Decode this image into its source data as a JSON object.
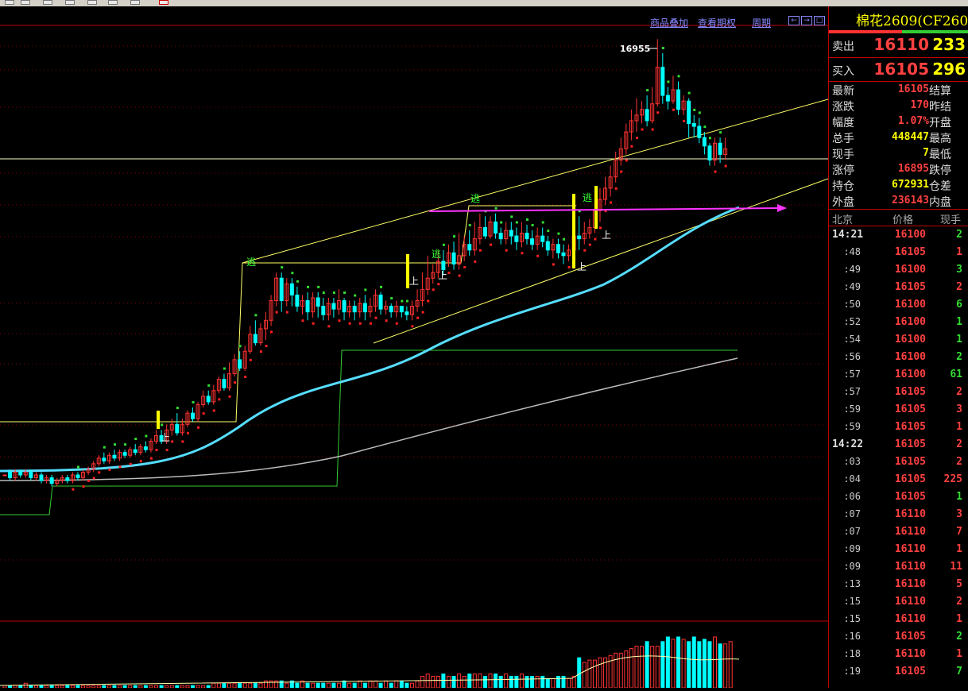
{
  "colors": {
    "background": "#000000",
    "up": "#ff3333",
    "down": "#00ffff",
    "yellow": "#ffff00",
    "green": "#33cc33",
    "magenta": "#ff33ff",
    "ma_fast": "#55ddff",
    "ma_slow": "#bbbbbb"
  },
  "toolbar": {
    "links": [
      "商品叠加",
      "查看期权",
      "周期"
    ],
    "nav_icons": [
      "zoom-in-icon",
      "zoom-out-icon",
      "restore-icon"
    ]
  },
  "chart": {
    "peak_label": "16955",
    "chart_data": {
      "type": "candlestick",
      "title": "",
      "xlabel": "",
      "ylabel": "",
      "peak_high": 16955,
      "signals": [
        "逃",
        "逃",
        "逃",
        "逃",
        "上",
        "上",
        "上",
        "上",
        "上"
      ],
      "candles": [
        [
          0.0,
          0.0,
          0.0,
          0.0
        ],
        [
          0.01,
          -0.01,
          0.02,
          -0.02
        ],
        [
          -0.01,
          0.01,
          0.02,
          -0.02
        ],
        [
          0.01,
          0.0,
          0.02,
          -0.01
        ],
        [
          0.0,
          0.01,
          0.02,
          -0.01
        ],
        [
          0.01,
          -0.01,
          0.02,
          -0.02
        ],
        [
          -0.01,
          0.0,
          0.01,
          -0.02
        ],
        [
          0.0,
          -0.02,
          0.01,
          -0.03
        ],
        [
          -0.02,
          -0.01,
          0.0,
          -0.03
        ],
        [
          -0.01,
          -0.03,
          0.0,
          -0.04
        ],
        [
          -0.03,
          -0.02,
          -0.01,
          -0.04
        ],
        [
          -0.02,
          -0.01,
          0.0,
          -0.03
        ],
        [
          -0.01,
          -0.02,
          0.0,
          -0.03
        ],
        [
          -0.02,
          0.0,
          0.01,
          -0.03
        ],
        [
          0.0,
          -0.01,
          0.01,
          -0.02
        ],
        [
          -0.01,
          0.01,
          0.02,
          -0.02
        ],
        [
          0.01,
          0.02,
          0.03,
          0.0
        ],
        [
          0.02,
          0.04,
          0.05,
          0.01
        ],
        [
          0.04,
          0.06,
          0.07,
          0.03
        ],
        [
          0.06,
          0.05,
          0.08,
          0.04
        ],
        [
          0.05,
          0.07,
          0.08,
          0.04
        ],
        [
          0.07,
          0.06,
          0.09,
          0.05
        ],
        [
          0.06,
          0.08,
          0.09,
          0.05
        ],
        [
          0.08,
          0.07,
          0.09,
          0.06
        ],
        [
          0.07,
          0.09,
          0.1,
          0.06
        ],
        [
          0.09,
          0.08,
          0.11,
          0.07
        ],
        [
          0.08,
          0.1,
          0.11,
          0.07
        ],
        [
          0.1,
          0.09,
          0.12,
          0.08
        ],
        [
          0.09,
          0.12,
          0.13,
          0.08
        ],
        [
          0.12,
          0.14,
          0.16,
          0.11
        ],
        [
          0.14,
          0.12,
          0.16,
          0.11
        ],
        [
          0.12,
          0.16,
          0.18,
          0.11
        ],
        [
          0.16,
          0.18,
          0.2,
          0.14
        ],
        [
          0.18,
          0.15,
          0.22,
          0.14
        ],
        [
          0.15,
          0.18,
          0.2,
          0.14
        ],
        [
          0.18,
          0.22,
          0.23,
          0.17
        ],
        [
          0.22,
          0.2,
          0.24,
          0.19
        ],
        [
          0.2,
          0.25,
          0.26,
          0.19
        ],
        [
          0.25,
          0.28,
          0.3,
          0.24
        ],
        [
          0.28,
          0.26,
          0.3,
          0.25
        ],
        [
          0.26,
          0.3,
          0.32,
          0.25
        ],
        [
          0.3,
          0.34,
          0.35,
          0.29
        ],
        [
          0.34,
          0.31,
          0.36,
          0.3
        ],
        [
          0.31,
          0.36,
          0.4,
          0.3
        ],
        [
          0.36,
          0.41,
          0.43,
          0.35
        ],
        [
          0.41,
          0.38,
          0.44,
          0.37
        ],
        [
          0.38,
          0.44,
          0.46,
          0.37
        ],
        [
          0.44,
          0.5,
          0.53,
          0.43
        ],
        [
          0.5,
          0.47,
          0.55,
          0.46
        ],
        [
          0.47,
          0.52,
          0.54,
          0.46
        ],
        [
          0.52,
          0.55,
          0.58,
          0.48
        ],
        [
          0.55,
          0.62,
          0.64,
          0.53
        ],
        [
          0.62,
          0.7,
          0.72,
          0.6
        ],
        [
          0.7,
          0.62,
          0.72,
          0.58
        ],
        [
          0.62,
          0.68,
          0.7,
          0.6
        ],
        [
          0.68,
          0.64,
          0.7,
          0.6
        ],
        [
          0.64,
          0.6,
          0.67,
          0.58
        ],
        [
          0.6,
          0.62,
          0.64,
          0.57
        ],
        [
          0.62,
          0.58,
          0.65,
          0.55
        ],
        [
          0.58,
          0.63,
          0.65,
          0.56
        ],
        [
          0.63,
          0.6,
          0.65,
          0.56
        ],
        [
          0.6,
          0.57,
          0.63,
          0.55
        ],
        [
          0.57,
          0.61,
          0.63,
          0.55
        ],
        [
          0.61,
          0.59,
          0.63,
          0.56
        ],
        [
          0.59,
          0.62,
          0.66,
          0.57
        ],
        [
          0.62,
          0.58,
          0.63,
          0.55
        ],
        [
          0.58,
          0.6,
          0.62,
          0.56
        ],
        [
          0.6,
          0.58,
          0.62,
          0.55
        ],
        [
          0.58,
          0.61,
          0.63,
          0.56
        ],
        [
          0.61,
          0.58,
          0.64,
          0.55
        ],
        [
          0.58,
          0.6,
          0.63,
          0.56
        ],
        [
          0.6,
          0.64,
          0.66,
          0.58
        ],
        [
          0.64,
          0.59,
          0.65,
          0.57
        ],
        [
          0.59,
          0.6,
          0.62,
          0.57
        ],
        [
          0.6,
          0.58,
          0.61,
          0.56
        ],
        [
          0.58,
          0.6,
          0.62,
          0.56
        ],
        [
          0.6,
          0.58,
          0.6,
          0.56
        ],
        [
          0.58,
          0.57,
          0.6,
          0.55
        ],
        [
          0.57,
          0.6,
          0.62,
          0.55
        ],
        [
          0.6,
          0.62,
          0.66,
          0.58
        ],
        [
          0.62,
          0.66,
          0.72,
          0.6
        ],
        [
          0.66,
          0.7,
          0.78,
          0.64
        ],
        [
          0.7,
          0.72,
          0.75,
          0.68
        ],
        [
          0.72,
          0.76,
          0.8,
          0.7
        ],
        [
          0.76,
          0.73,
          0.8,
          0.71
        ],
        [
          0.76,
          0.79,
          0.82,
          0.74
        ],
        [
          0.79,
          0.75,
          0.83,
          0.73
        ],
        [
          0.75,
          0.78,
          0.86,
          0.73
        ],
        [
          0.78,
          0.82,
          0.85,
          0.76
        ],
        [
          0.82,
          0.8,
          0.87,
          0.78
        ],
        [
          0.8,
          0.84,
          0.9,
          0.78
        ],
        [
          0.84,
          0.88,
          0.93,
          0.82
        ],
        [
          0.88,
          0.85,
          0.92,
          0.84
        ],
        [
          0.85,
          0.9,
          0.92,
          0.84
        ],
        [
          0.9,
          0.86,
          0.93,
          0.84
        ],
        [
          0.86,
          0.84,
          0.88,
          0.82
        ],
        [
          0.84,
          0.87,
          0.9,
          0.82
        ],
        [
          0.87,
          0.85,
          0.9,
          0.82
        ],
        [
          0.85,
          0.83,
          0.88,
          0.8
        ],
        [
          0.83,
          0.86,
          0.9,
          0.81
        ],
        [
          0.86,
          0.84,
          0.89,
          0.82
        ],
        [
          0.84,
          0.82,
          0.87,
          0.8
        ],
        [
          0.82,
          0.85,
          0.88,
          0.8
        ],
        [
          0.85,
          0.83,
          0.88,
          0.81
        ],
        [
          0.83,
          0.8,
          0.85,
          0.78
        ],
        [
          0.8,
          0.82,
          0.84,
          0.77
        ],
        [
          0.82,
          0.79,
          0.84,
          0.77
        ],
        [
          0.79,
          0.78,
          0.82,
          0.75
        ],
        [
          0.78,
          0.8,
          0.82,
          0.76
        ],
        [
          0.8,
          0.85,
          0.93,
          0.79
        ],
        [
          0.85,
          0.84,
          0.92,
          0.8
        ],
        [
          0.84,
          0.86,
          0.9,
          0.82
        ],
        [
          0.86,
          0.88,
          0.91,
          0.84
        ],
        [
          0.88,
          0.94,
          0.98,
          0.86
        ],
        [
          0.94,
          0.98,
          1.02,
          0.9
        ],
        [
          0.98,
          1.02,
          1.06,
          0.96
        ],
        [
          1.02,
          1.06,
          1.1,
          0.99
        ],
        [
          1.06,
          1.12,
          1.15,
          1.04
        ],
        [
          1.12,
          1.16,
          1.2,
          1.1
        ],
        [
          1.16,
          1.22,
          1.25,
          1.14
        ],
        [
          1.22,
          1.26,
          1.3,
          1.19
        ],
        [
          1.26,
          1.28,
          1.34,
          1.22
        ],
        [
          1.28,
          1.3,
          1.33,
          1.25
        ],
        [
          1.3,
          1.26,
          1.35,
          1.24
        ],
        [
          1.26,
          1.32,
          1.38,
          1.25
        ],
        [
          1.32,
          1.45,
          1.55,
          1.31
        ],
        [
          1.45,
          1.35,
          1.5,
          1.32
        ],
        [
          1.35,
          1.33,
          1.38,
          1.3
        ],
        [
          1.33,
          1.37,
          1.42,
          1.32
        ],
        [
          1.37,
          1.3,
          1.4,
          1.28
        ],
        [
          1.3,
          1.33,
          1.35,
          1.28
        ],
        [
          1.33,
          1.25,
          1.34,
          1.2
        ],
        [
          1.25,
          1.24,
          1.28,
          1.2
        ],
        [
          1.24,
          1.2,
          1.27,
          1.18
        ],
        [
          1.2,
          1.17,
          1.22,
          1.14
        ],
        [
          1.17,
          1.12,
          1.18,
          1.1
        ],
        [
          1.12,
          1.18,
          1.2,
          1.1
        ],
        [
          1.18,
          1.14,
          1.2,
          1.11
        ],
        [
          1.14,
          1.16,
          1.2,
          1.12
        ]
      ],
      "volume": [
        1,
        1,
        1,
        1,
        2,
        1,
        1,
        1,
        1,
        1,
        1,
        1,
        1,
        1,
        1,
        1,
        1,
        1,
        1,
        1,
        1,
        1,
        1,
        1,
        1,
        1,
        1,
        1,
        1,
        1,
        1,
        1,
        1,
        1,
        1,
        1,
        1,
        1,
        1,
        1,
        2,
        2,
        2,
        2,
        2,
        2,
        2,
        2,
        2,
        2,
        3,
        3,
        3,
        3,
        2,
        3,
        2,
        3,
        2,
        2,
        2,
        2,
        2,
        2,
        2,
        3,
        2,
        2,
        3,
        2,
        3,
        3,
        2,
        3,
        2,
        3,
        3,
        2,
        2,
        3,
        5,
        6,
        5,
        5,
        6,
        5,
        5,
        6,
        5,
        6,
        6,
        6,
        5,
        6,
        6,
        5,
        6,
        5,
        5,
        6,
        5,
        5,
        5,
        5,
        4,
        4,
        5,
        5,
        4,
        5,
        13,
        11,
        12,
        12,
        13,
        13,
        14,
        15,
        15,
        16,
        17,
        18,
        18,
        20,
        18,
        18,
        20,
        22,
        21,
        22,
        21,
        20,
        22,
        20,
        21,
        20,
        22,
        19,
        19,
        20
      ]
    }
  },
  "panel": {
    "title": "棉花2609(CF260",
    "sell_label": "卖出",
    "sell_price": "16110",
    "sell_vol": "233",
    "buy_label": "买入",
    "buy_price": "16105",
    "buy_vol": "296",
    "quote": [
      {
        "label": "最新",
        "value": "16105",
        "right": "结算",
        "color": "#ff4040"
      },
      {
        "label": "涨跌",
        "value": "170",
        "right": "昨结",
        "color": "#ff4040"
      },
      {
        "label": "幅度",
        "value": "1.07%",
        "right": "开盘",
        "color": "#ff4040"
      },
      {
        "label": "总手",
        "value": "448447",
        "right": "最高",
        "color": "#ffff00"
      },
      {
        "label": "现手",
        "value": "7",
        "right": "最低",
        "color": "#ffff00"
      },
      {
        "label": "涨停",
        "value": "16895",
        "right": "跌停",
        "color": "#ff4040"
      },
      {
        "label": "持仓",
        "value": "672931",
        "right": "仓差",
        "color": "#ffff00"
      },
      {
        "label": "外盘",
        "value": "236143",
        "right": "内盘",
        "color": "#ff4040"
      }
    ],
    "tick_headers": [
      "北京",
      "价格",
      "现手"
    ],
    "ticks": [
      {
        "time": "14:21",
        "price": "16100",
        "vol": "2",
        "pc": "#ff4040",
        "vc": "#33dd33",
        "full": true
      },
      {
        "time": ":48",
        "price": "16105",
        "vol": "1",
        "pc": "#ff4040",
        "vc": "#ff4040"
      },
      {
        "time": ":49",
        "price": "16100",
        "vol": "3",
        "pc": "#ff4040",
        "vc": "#33dd33"
      },
      {
        "time": ":49",
        "price": "16105",
        "vol": "2",
        "pc": "#ff4040",
        "vc": "#ff4040"
      },
      {
        "time": ":50",
        "price": "16100",
        "vol": "6",
        "pc": "#ff4040",
        "vc": "#33dd33"
      },
      {
        "time": ":52",
        "price": "16100",
        "vol": "1",
        "pc": "#ff4040",
        "vc": "#33dd33"
      },
      {
        "time": ":54",
        "price": "16100",
        "vol": "1",
        "pc": "#ff4040",
        "vc": "#33dd33"
      },
      {
        "time": ":56",
        "price": "16100",
        "vol": "2",
        "pc": "#ff4040",
        "vc": "#33dd33"
      },
      {
        "time": ":57",
        "price": "16100",
        "vol": "61",
        "pc": "#ff4040",
        "vc": "#33dd33"
      },
      {
        "time": ":57",
        "price": "16105",
        "vol": "2",
        "pc": "#ff4040",
        "vc": "#ff4040"
      },
      {
        "time": ":59",
        "price": "16105",
        "vol": "3",
        "pc": "#ff4040",
        "vc": "#ff4040"
      },
      {
        "time": ":59",
        "price": "16105",
        "vol": "1",
        "pc": "#ff4040",
        "vc": "#ff4040"
      },
      {
        "time": "14:22",
        "price": "16105",
        "vol": "2",
        "pc": "#ff4040",
        "vc": "#ff4040",
        "full": true
      },
      {
        "time": ":03",
        "price": "16105",
        "vol": "2",
        "pc": "#ff4040",
        "vc": "#ff4040"
      },
      {
        "time": ":04",
        "price": "16105",
        "vol": "225",
        "pc": "#ff4040",
        "vc": "#ff4040"
      },
      {
        "time": ":06",
        "price": "16105",
        "vol": "1",
        "pc": "#ff4040",
        "vc": "#33dd33"
      },
      {
        "time": ":07",
        "price": "16110",
        "vol": "3",
        "pc": "#ff4040",
        "vc": "#ff4040"
      },
      {
        "time": ":07",
        "price": "16110",
        "vol": "7",
        "pc": "#ff4040",
        "vc": "#ff4040"
      },
      {
        "time": ":09",
        "price": "16110",
        "vol": "1",
        "pc": "#ff4040",
        "vc": "#ff4040"
      },
      {
        "time": ":09",
        "price": "16110",
        "vol": "11",
        "pc": "#ff4040",
        "vc": "#ff4040"
      },
      {
        "time": ":13",
        "price": "16110",
        "vol": "5",
        "pc": "#ff4040",
        "vc": "#ff4040"
      },
      {
        "time": ":15",
        "price": "16110",
        "vol": "2",
        "pc": "#ff4040",
        "vc": "#ff4040"
      },
      {
        "time": ":15",
        "price": "16110",
        "vol": "1",
        "pc": "#ff4040",
        "vc": "#ff4040"
      },
      {
        "time": ":16",
        "price": "16105",
        "vol": "2",
        "pc": "#ff4040",
        "vc": "#33dd33"
      },
      {
        "time": ":18",
        "price": "16110",
        "vol": "1",
        "pc": "#ff4040",
        "vc": "#ff4040"
      },
      {
        "time": ":19",
        "price": "16105",
        "vol": "7",
        "pc": "#ff4040",
        "vc": "#33dd33"
      }
    ]
  }
}
